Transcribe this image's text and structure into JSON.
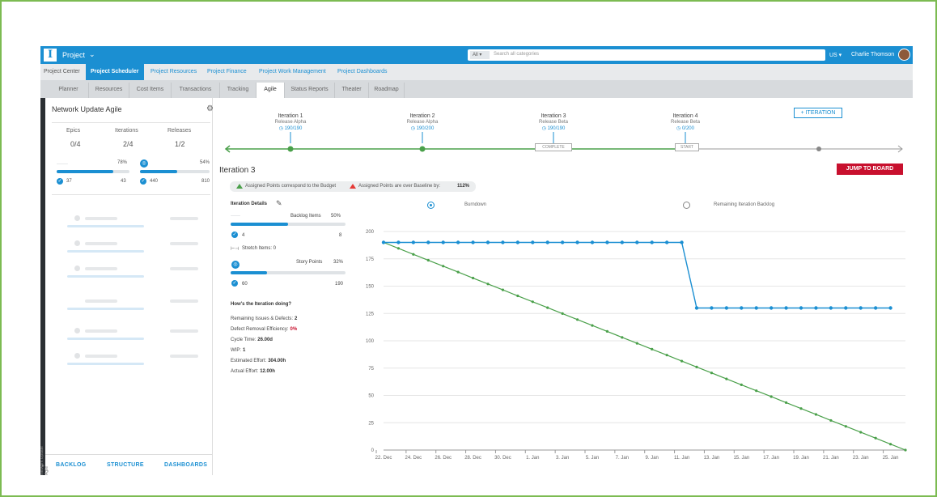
{
  "header": {
    "app_name": "Project",
    "search_scope": "All",
    "search_placeholder": "Search all categories",
    "region": "US",
    "user_name": "Charlie Thomson"
  },
  "modules": [
    "Project Center",
    "Project Scheduler",
    "Project Resources",
    "Project Finance",
    "Project Work Management",
    "Project Dashboards"
  ],
  "tabs": [
    "Planner",
    "Resources",
    "Cost Items",
    "Transactions",
    "Tracking",
    "Agile",
    "Status Reports",
    "Theater",
    "Roadmap"
  ],
  "left": {
    "title": "Network Update Agile",
    "stats": [
      {
        "label": "Epics",
        "value": "0/4"
      },
      {
        "label": "Iterations",
        "value": "2/4"
      },
      {
        "label": "Releases",
        "value": "1/2"
      }
    ],
    "bar1": {
      "pct_label": "78%",
      "pct": 0.78,
      "done": "37",
      "total": "43"
    },
    "bar2": {
      "pct_label": "54%",
      "pct": 0.54,
      "done": "440",
      "total": "810"
    },
    "rail_text": "Network Update Agile",
    "nav": [
      "BACKLOG",
      "STRUCTURE",
      "DASHBOARDS"
    ]
  },
  "iterations": [
    {
      "name": "Iteration 1",
      "release": "Release Alpha",
      "points": "190/190"
    },
    {
      "name": "Iteration 2",
      "release": "Release Alpha",
      "points": "190/200"
    },
    {
      "name": "Iteration 3",
      "release": "Release Beta",
      "points": "190/190",
      "stage": "COMPLETE"
    },
    {
      "name": "Iteration 4",
      "release": "Release Beta",
      "points": "0/200",
      "stage": "START"
    }
  ],
  "add_iteration": "+ ITERATION",
  "current_iteration": "Iteration 3",
  "jump_button": "JUMP TO BOARD",
  "legend": {
    "green": "Assigned Points correspond to the Budget",
    "red": "Assigned Points are over Baseline by:",
    "red_value": "112%"
  },
  "details": {
    "title": "Iteration Details",
    "backlog_label": "Backlog Items",
    "backlog_pct_label": "50%",
    "backlog_pct": 0.5,
    "backlog_done": "4",
    "backlog_total": "8",
    "stretch": "Stretch Items: 0",
    "story_label": "Story Points",
    "story_pct_label": "32%",
    "story_pct": 0.32,
    "story_done": "60",
    "story_total": "190",
    "how": "How's the Iteration doing?",
    "rows": [
      {
        "label": "Remaining Issues & Defects:",
        "value": "2"
      },
      {
        "label": "Defect Removal Efficiency:",
        "value": "0%"
      },
      {
        "label": "Cycle Time:",
        "value": "26.00d"
      },
      {
        "label": "WIP:",
        "value": "1"
      },
      {
        "label": "Estimated Effort:",
        "value": "304.00h"
      },
      {
        "label": "Actual Effort:",
        "value": "12.00h"
      }
    ]
  },
  "chart_toggle": {
    "burndown": "Burndown",
    "remaining": "Remaining Iteration Backlog"
  },
  "chart_data": {
    "type": "line",
    "x": [
      "22. Dec",
      "23. Dec",
      "24. Dec",
      "25. Dec",
      "26. Dec",
      "27. Dec",
      "28. Dec",
      "29. Dec",
      "30. Dec",
      "31. Dec",
      "1. Jan",
      "2. Jan",
      "3. Jan",
      "4. Jan",
      "5. Jan",
      "6. Jan",
      "7. Jan",
      "8. Jan",
      "9. Jan",
      "10. Jan",
      "11. Jan",
      "12. Jan",
      "13. Jan",
      "14. Jan",
      "15. Jan",
      "16. Jan",
      "17. Jan",
      "18. Jan",
      "19. Jan",
      "20. Jan",
      "21. Jan",
      "22. Jan",
      "23. Jan",
      "24. Jan",
      "25. Jan",
      "26. Jan"
    ],
    "tick_labels": [
      "22. Dec",
      "24. Dec",
      "26. Dec",
      "28. Dec",
      "30. Dec",
      "1. Jan",
      "3. Jan",
      "5. Jan",
      "7. Jan",
      "9. Jan",
      "11. Jan",
      "13. Jan",
      "15. Jan",
      "17. Jan",
      "19. Jan",
      "21. Jan",
      "23. Jan",
      "25. Jan"
    ],
    "y_ticks": [
      0,
      25,
      50,
      75,
      100,
      125,
      150,
      175,
      200
    ],
    "ylim": [
      0,
      200
    ],
    "series": [
      {
        "name": "Burndown",
        "color": "#1b8fd2",
        "values": [
          190,
          190,
          190,
          190,
          190,
          190,
          190,
          190,
          190,
          190,
          190,
          190,
          190,
          190,
          190,
          190,
          190,
          190,
          190,
          190,
          190,
          130,
          130,
          130,
          130,
          130,
          130,
          130,
          130,
          130,
          130,
          130,
          130,
          130,
          130,
          null
        ]
      },
      {
        "color": "#4aa04a",
        "values": [
          190,
          184.6,
          179.1,
          173.7,
          168.3,
          162.9,
          157.4,
          152,
          146.6,
          141.1,
          135.7,
          130.3,
          124.9,
          119.4,
          114,
          108.6,
          103.1,
          97.7,
          92.3,
          86.9,
          81.4,
          76,
          70.6,
          65.1,
          59.7,
          54.3,
          48.9,
          43.4,
          38,
          32.6,
          27.1,
          21.7,
          16.3,
          10.9,
          5.4,
          0
        ]
      }
    ],
    "grid": true
  },
  "colors": {
    "accent": "#1b8fd2",
    "alert": "#c8102e",
    "ok": "#4aa04a"
  }
}
